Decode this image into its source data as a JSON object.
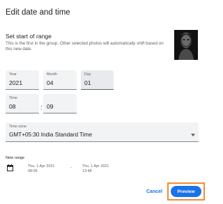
{
  "dialog": {
    "title": "Edit date and time"
  },
  "range": {
    "heading": "Set start of range",
    "description": "This is the first in the group. Other selected photos will automatically shift based on this new date."
  },
  "fields": {
    "year": {
      "label": "Year",
      "value": "2021"
    },
    "month": {
      "label": "Month",
      "value": "04"
    },
    "day": {
      "label": "Day",
      "value": "01"
    },
    "time": {
      "label": "Time",
      "hour": "08",
      "separator": ":",
      "minute": "09"
    },
    "timezone": {
      "label": "Time zone",
      "value": "GMT+05:30 India Standard Time"
    }
  },
  "new_range": {
    "label": "New range",
    "start_date": "Thu, 1 Apr 2021",
    "start_time": "08:09",
    "separator": "-",
    "end_date": "Thu, 1 Apr 2021",
    "end_time": "13:48"
  },
  "actions": {
    "cancel": "Cancel",
    "preview": "Preview"
  },
  "colors": {
    "accent": "#1a73e8",
    "highlight": "#f28c38"
  },
  "icons": {
    "calendar": "calendar-icon",
    "dropdown": "chevron-down-icon"
  }
}
